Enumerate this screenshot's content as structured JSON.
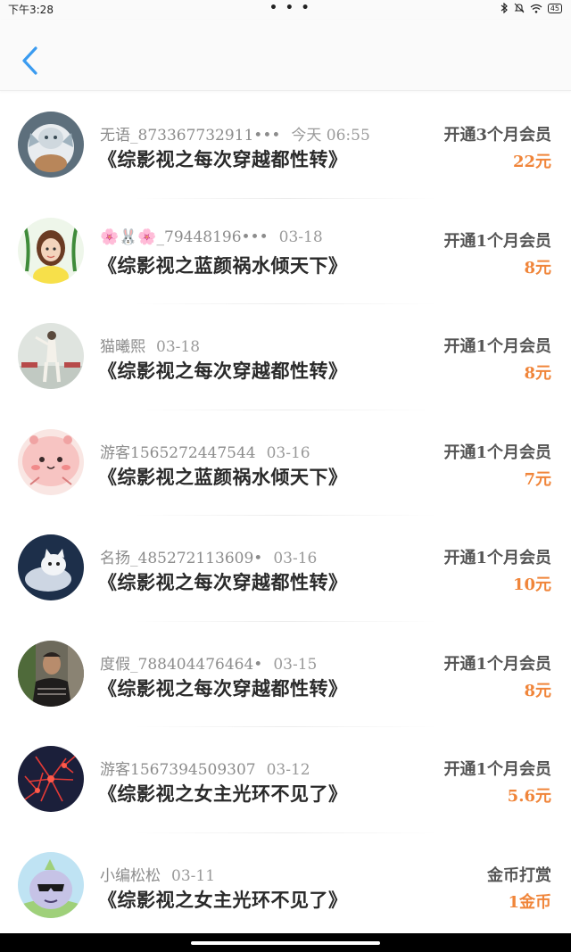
{
  "status_bar": {
    "time": "下午3:28",
    "dots": "• • •",
    "battery": "45"
  },
  "header": {
    "back_icon": "chevron-left-icon",
    "accent_color": "#3a9bf0"
  },
  "rows": [
    {
      "user": "无语_873367732911•••",
      "time": "今天 06:55",
      "title": "《综影视之每次穿越都性转》",
      "action": "开通3个月会员",
      "amount": "22元",
      "avatar": "white-dragon-figurine"
    },
    {
      "user": "🌸🐰🌸_79448196•••",
      "time": "03-18",
      "title": "《综影视之蓝颜祸水倾天下》",
      "action": "开通1个月会员",
      "amount": "8元",
      "avatar": "cartoon-girl-leaves"
    },
    {
      "user": "猫曦熙",
      "time": "03-18",
      "title": "《综影视之每次穿越都性转》",
      "action": "开通1个月会员",
      "amount": "8元",
      "avatar": "dancer-photo"
    },
    {
      "user": "游客1565272447544",
      "time": "03-16",
      "title": "《综影视之蓝颜祸水倾天下》",
      "action": "开通1个月会员",
      "amount": "7元",
      "avatar": "pink-blob-character"
    },
    {
      "user": "名扬_485272113609•",
      "time": "03-16",
      "title": "《综影视之每次穿越都性转》",
      "action": "开通1个月会员",
      "amount": "10元",
      "avatar": "white-cat-photo"
    },
    {
      "user": "度假_788404476464•",
      "time": "03-15",
      "title": "《综影视之每次穿越都性转》",
      "action": "开通1个月会员",
      "amount": "8元",
      "avatar": "man-photo"
    },
    {
      "user": "游客1567394509307",
      "time": "03-12",
      "title": "《综影视之女主光环不见了》",
      "action": "开通1个月会员",
      "amount": "5.6元",
      "avatar": "red-flowers-photo"
    },
    {
      "user": "小编松松",
      "time": "03-11",
      "title": "《综影视之女主光环不见了》",
      "action": "金币打赏",
      "amount": "1金币",
      "avatar": "cartoon-sunglasses-character"
    }
  ]
}
